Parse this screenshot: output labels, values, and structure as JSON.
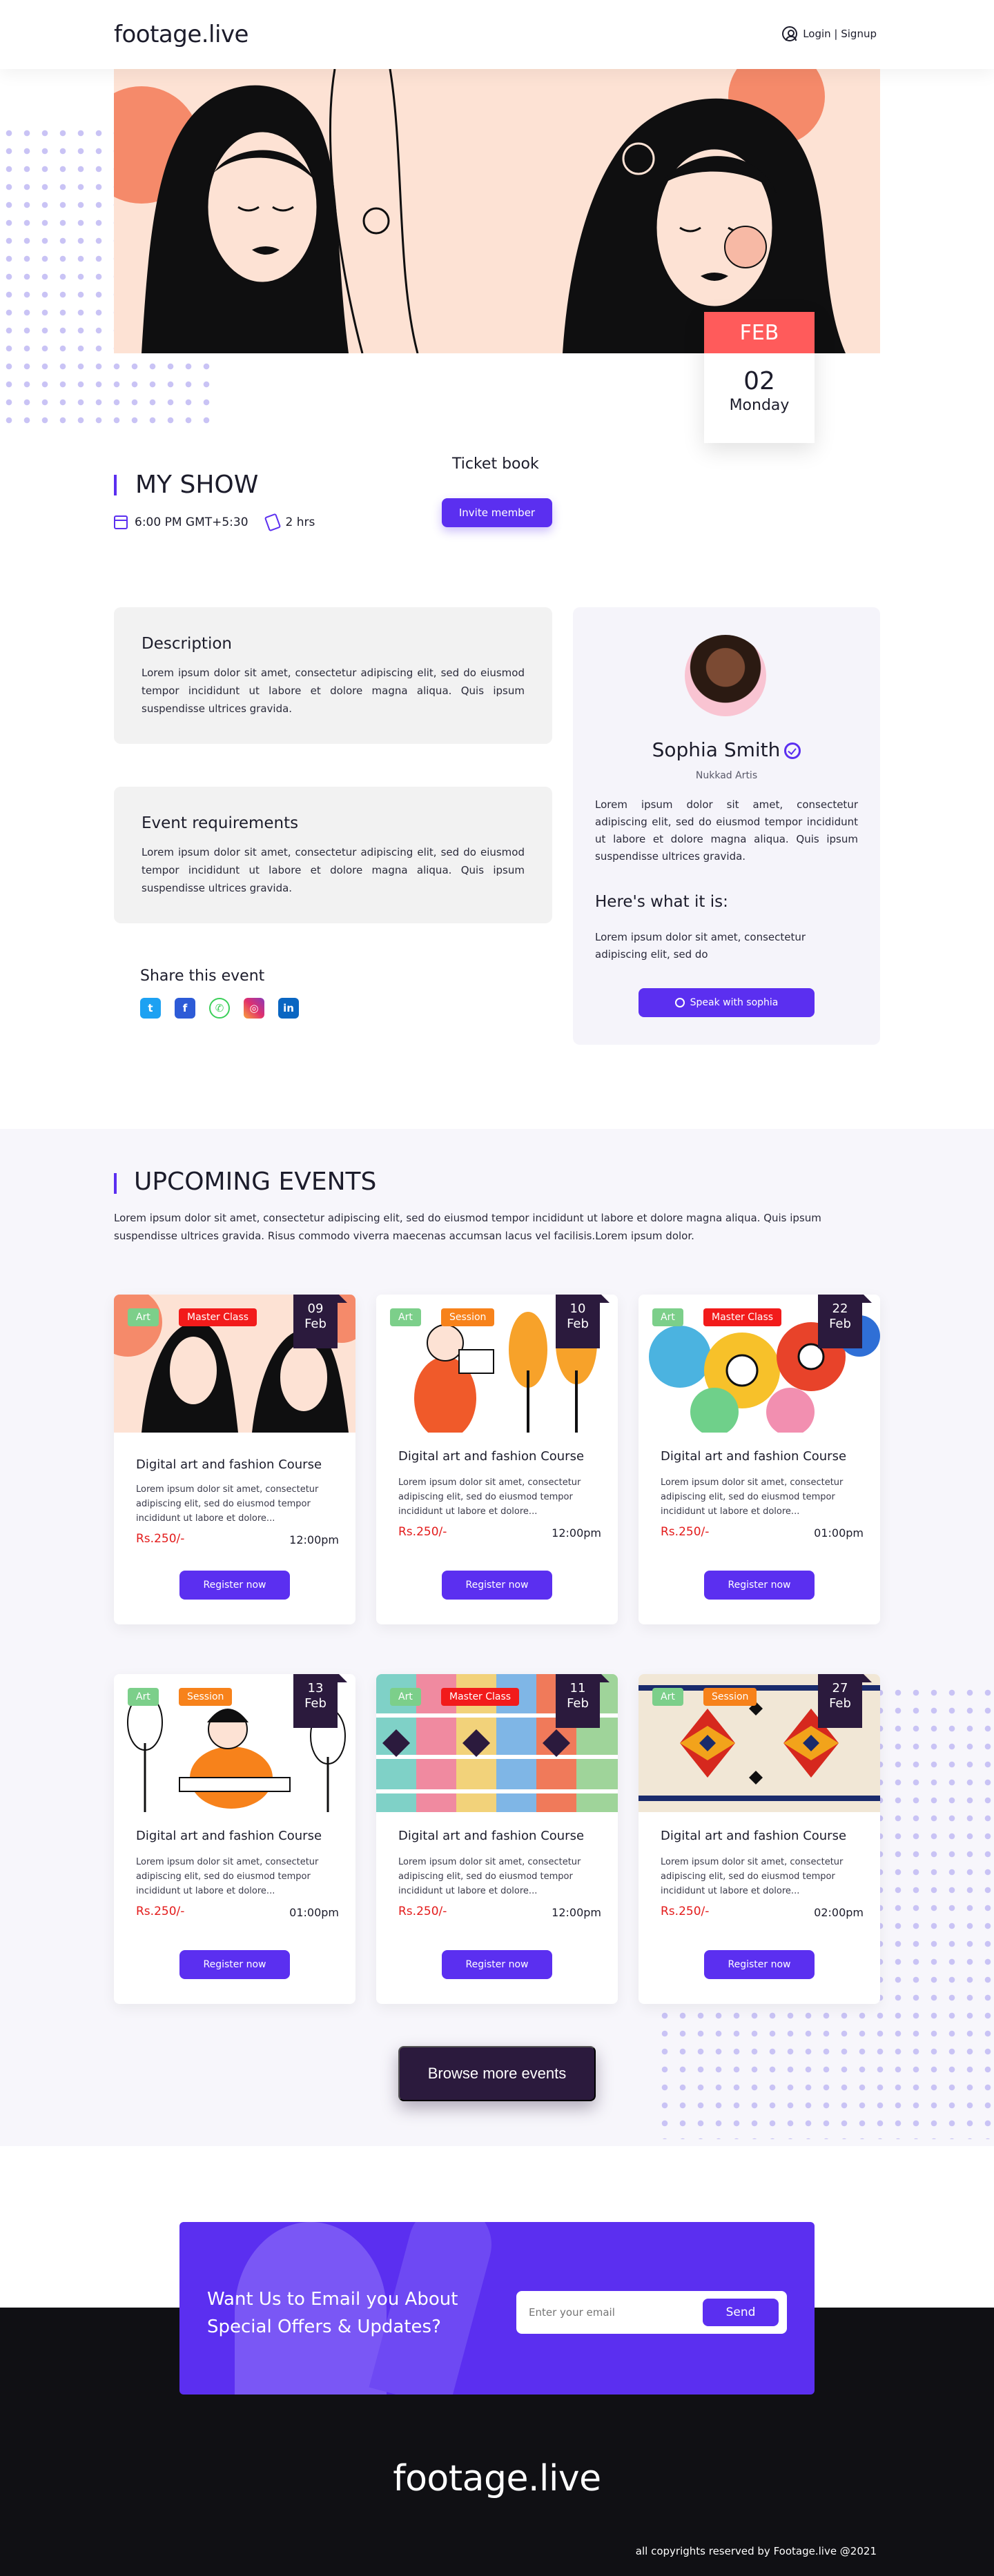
{
  "header": {
    "logo": "footage.live",
    "login": "Login | Signup"
  },
  "show": {
    "month": "FEB",
    "day": "02",
    "weekday": "Monday",
    "title": "MY SHOW",
    "time": "6:00 PM GMT+5:30",
    "duration": "2 hrs",
    "ticket_label": "Ticket book",
    "invite_label": "Invite member"
  },
  "description": {
    "title": "Description",
    "text": "Lorem ipsum dolor sit amet, consectetur adipiscing elit, sed do eiusmod tempor incididunt ut labore et dolore magna aliqua. Quis ipsum suspendisse ultrices gravida."
  },
  "requirements": {
    "title": "Event requirements",
    "text": "Lorem ipsum dolor sit amet, consectetur adipiscing elit, sed do eiusmod tempor incididunt ut labore et dolore magna aliqua. Quis ipsum suspendisse ultrices gravida."
  },
  "share": {
    "title": "Share this event",
    "icons": [
      "twitter-icon",
      "facebook-icon",
      "whatsapp-icon",
      "instagram-icon",
      "linkedin-icon"
    ]
  },
  "artist": {
    "name": "Sophia Smith",
    "role": "Nukkad Artis",
    "bio": "Lorem ipsum dolor sit amet, consectetur adipiscing elit, sed do eiusmod tempor incididunt ut labore et dolore magna aliqua. Quis ipsum suspendisse ultrices gravida.",
    "sub_title": "Here's what it is:",
    "sub_text": "Lorem ipsum dolor sit amet, consectetur adipiscing elit, sed do",
    "speak_label": "Speak with sophia"
  },
  "upcoming": {
    "title": "UPCOMING EVENTS",
    "description": "Lorem ipsum dolor sit amet, consectetur adipiscing elit, sed do eiusmod tempor incididunt ut labore et dolore magna aliqua. Quis ipsum suspendisse ultrices gravida. Risus commodo viverra maecenas accumsan lacus vel facilisis.Lorem ipsum dolor.",
    "events": [
      {
        "tag1": "Art",
        "tag2": "Master Class",
        "day": "09",
        "month": "Feb",
        "title": "Digital art and fashion Course",
        "text": "Lorem ipsum dolor sit amet, consectetur adipiscing elit, sed do eiusmod tempor incididunt ut labore et dolore...",
        "price": "Rs.250/-",
        "time": "12:00pm",
        "button": "Register now"
      },
      {
        "tag1": "Art",
        "tag2": "Session",
        "day": "10",
        "month": "Feb",
        "title": "Digital art and fashion Course",
        "text": "Lorem ipsum dolor sit amet, consectetur adipiscing elit, sed do eiusmod tempor incididunt ut labore et dolore...",
        "price": "Rs.250/-",
        "time": "12:00pm",
        "button": "Register now"
      },
      {
        "tag1": "Art",
        "tag2": "Master Class",
        "day": "22",
        "month": "Feb",
        "title": "Digital art and fashion Course",
        "text": "Lorem ipsum dolor sit amet, consectetur adipiscing elit, sed do eiusmod tempor incididunt ut labore et dolore...",
        "price": "Rs.250/-",
        "time": "01:00pm",
        "button": "Register now"
      },
      {
        "tag1": "Art",
        "tag2": "Session",
        "day": "13",
        "month": "Feb",
        "title": "Digital art and fashion Course",
        "text": "Lorem ipsum dolor sit amet, consectetur adipiscing elit, sed do eiusmod tempor incididunt ut labore et dolore...",
        "price": "Rs.250/-",
        "time": "01:00pm",
        "button": "Register now"
      },
      {
        "tag1": "Art",
        "tag2": "Master Class",
        "day": "11",
        "month": "Feb",
        "title": "Digital art and fashion Course",
        "text": "Lorem ipsum dolor sit amet, consectetur adipiscing elit, sed do eiusmod tempor incididunt ut labore et dolore...",
        "price": "Rs.250/-",
        "time": "12:00pm",
        "button": "Register now"
      },
      {
        "tag1": "Art",
        "tag2": "Session",
        "day": "27",
        "month": "Feb",
        "title": "Digital art and fashion Course",
        "text": "Lorem ipsum dolor sit amet, consectetur adipiscing elit, sed do eiusmod tempor incididunt ut labore et dolore...",
        "price": "Rs.250/-",
        "time": "02:00pm",
        "button": "Register now"
      }
    ],
    "browse_label": "Browse more events"
  },
  "newsletter": {
    "title": "Want Us to Email you About Special Offers & Updates?",
    "placeholder": "Enter your email",
    "send_label": "Send"
  },
  "footer": {
    "logo": "footage.live",
    "copyright": "all copyrights reserved by Footage.live @2021"
  },
  "colors": {
    "accent": "#5b2ff0",
    "date_red": "#ff5b5b",
    "dark": "#2b1a3d",
    "price_red": "#e31b1b",
    "tag_green": "#7ccf8a",
    "tag_red": "#f21b1b",
    "tag_orange": "#f7821b"
  }
}
